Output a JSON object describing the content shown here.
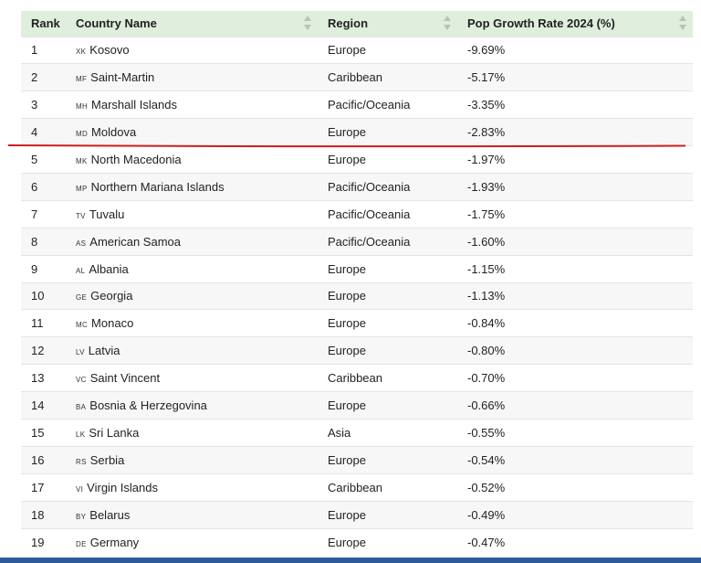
{
  "table": {
    "headers": {
      "rank": "Rank",
      "country": "Country Name",
      "region": "Region",
      "growth": "Pop Growth Rate 2024 (%)"
    },
    "rows": [
      {
        "rank": "1",
        "code": "xk",
        "name": "Kosovo",
        "region": "Europe",
        "growth": "-9.69%"
      },
      {
        "rank": "2",
        "code": "mf",
        "name": "Saint-Martin",
        "region": "Caribbean",
        "growth": "-5.17%"
      },
      {
        "rank": "3",
        "code": "mh",
        "name": "Marshall Islands",
        "region": "Pacific/Oceania",
        "growth": "-3.35%"
      },
      {
        "rank": "4",
        "code": "md",
        "name": "Moldova",
        "region": "Europe",
        "growth": "-2.83%"
      },
      {
        "rank": "5",
        "code": "mk",
        "name": "North Macedonia",
        "region": "Europe",
        "growth": "-1.97%"
      },
      {
        "rank": "6",
        "code": "mp",
        "name": "Northern Mariana Islands",
        "region": "Pacific/Oceania",
        "growth": "-1.93%"
      },
      {
        "rank": "7",
        "code": "tv",
        "name": "Tuvalu",
        "region": "Pacific/Oceania",
        "growth": "-1.75%"
      },
      {
        "rank": "8",
        "code": "as",
        "name": "American Samoa",
        "region": "Pacific/Oceania",
        "growth": "-1.60%"
      },
      {
        "rank": "9",
        "code": "al",
        "name": "Albania",
        "region": "Europe",
        "growth": "-1.15%"
      },
      {
        "rank": "10",
        "code": "ge",
        "name": "Georgia",
        "region": "Europe",
        "growth": "-1.13%"
      },
      {
        "rank": "11",
        "code": "mc",
        "name": "Monaco",
        "region": "Europe",
        "growth": "-0.84%"
      },
      {
        "rank": "12",
        "code": "lv",
        "name": "Latvia",
        "region": "Europe",
        "growth": "-0.80%"
      },
      {
        "rank": "13",
        "code": "vc",
        "name": "Saint Vincent",
        "region": "Caribbean",
        "growth": "-0.70%"
      },
      {
        "rank": "14",
        "code": "ba",
        "name": "Bosnia & Herzegovina",
        "region": "Europe",
        "growth": "-0.66%"
      },
      {
        "rank": "15",
        "code": "lk",
        "name": "Sri Lanka",
        "region": "Asia",
        "growth": "-0.55%"
      },
      {
        "rank": "16",
        "code": "rs",
        "name": "Serbia",
        "region": "Europe",
        "growth": "-0.54%"
      },
      {
        "rank": "17",
        "code": "vi",
        "name": "Virgin Islands",
        "region": "Caribbean",
        "growth": "-0.52%"
      },
      {
        "rank": "18",
        "code": "by",
        "name": "Belarus",
        "region": "Europe",
        "growth": "-0.49%"
      },
      {
        "rank": "19",
        "code": "de",
        "name": "Germany",
        "region": "Europe",
        "growth": "-0.47%"
      }
    ]
  },
  "colors": {
    "header_bg": "#dfeedd",
    "annotation_line": "#cc1f1f",
    "bottom_bar": "#2d5b9a"
  },
  "icons": {
    "sort": "sort-arrows-icon"
  }
}
